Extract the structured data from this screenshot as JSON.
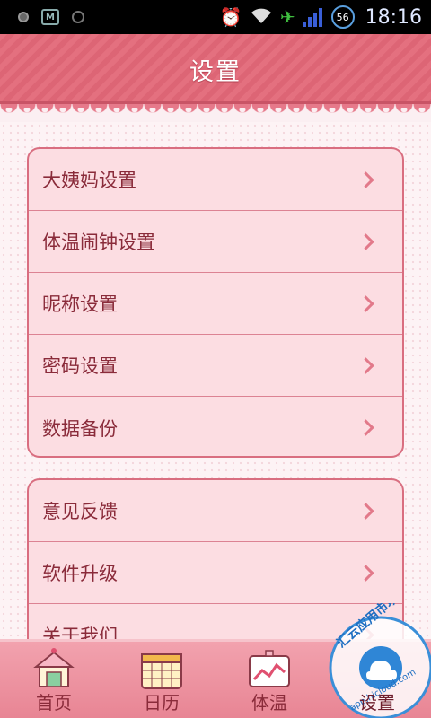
{
  "status_bar": {
    "time": "18:16",
    "battery_badge": "56",
    "icons": [
      "record-icon",
      "app-m-icon",
      "smiley-icon",
      "alarm-icon",
      "wifi-icon",
      "airplane-icon",
      "signal-icon",
      "battery-icon"
    ]
  },
  "header": {
    "title": "设置"
  },
  "settings": {
    "group1": [
      {
        "label": "大姨妈设置"
      },
      {
        "label": "体温闹钟设置"
      },
      {
        "label": "昵称设置"
      },
      {
        "label": "密码设置"
      },
      {
        "label": "数据备份"
      }
    ],
    "group2": [
      {
        "label": "意见反馈"
      },
      {
        "label": "软件升级"
      },
      {
        "label": "关于我们"
      }
    ]
  },
  "nav": {
    "tabs": [
      {
        "label": "首页",
        "icon": "house-icon"
      },
      {
        "label": "日历",
        "icon": "calendar-icon"
      },
      {
        "label": "体温",
        "icon": "chart-icon"
      },
      {
        "label": "设置",
        "icon": "settings-icon"
      }
    ],
    "active": 3
  },
  "watermark": {
    "text": "汇云应用市场",
    "url": "app.hicloud.com"
  },
  "colors": {
    "accent": "#e4707f",
    "row_bg": "#fcdde2",
    "text": "#8a2b3a"
  }
}
